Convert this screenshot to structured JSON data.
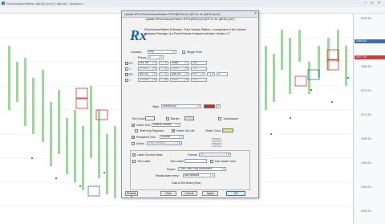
{
  "window": {
    "title": "PriceVolumePattern @ES#  [1m*] 1 Minute*, Session:1"
  },
  "chart": {
    "axis_labels": [
      "2090.00",
      "2085.00",
      "2080.00",
      "2075.00",
      "2070.00",
      "2065.00",
      "2060.00",
      "2055.00",
      "2050.00"
    ],
    "tags": [
      "2084.50",
      "2077.25"
    ]
  },
  "dialog": {
    "title": "Update RFCCPriceVolumePattern RTIC@ES# [1m*]CP-A: for @ES# [1m*]",
    "header": "Update hPriceVolumePattern RTIC@ES# [1m*]CP-A: for @ES# [1m*]",
    "description": "PriceVolumePattern Extension: Price Volume Pattern, a component of the Volume Analyses Package, is a PricevVolume Analyses indicator. Version 1.7",
    "location_label": "Location",
    "location_value": "Any",
    "single_price_label": "Single Price",
    "prices_label": "Prices",
    "prices_value": "2",
    "rows": [
      {
        "label": "P1:",
        "a": "Ask Vol",
        "op1": ">",
        "b": "Value",
        "v": "100",
        "enabled": true
      },
      {
        "label": "&:",
        "a": "Volume",
        "op1": ">",
        "b": "Value",
        "v": "100",
        "enabled": false
      },
      {
        "label": "P2:",
        "a": "Bid Vol",
        "op1": ">",
        "b": "Ask Vol",
        "v": "P2+",
        "op2": "*",
        "v2": "3",
        "enabled": true
      },
      {
        "label": "&:",
        "a": "Volume",
        "op1": ">",
        "b": "Value",
        "v": "100",
        "enabled": false
      }
    ],
    "style_label": "Style:",
    "style_value": "Hollow Box",
    "text_color_label": "Text Color:",
    "border_label": "Border",
    "translucent_label": "Translucent",
    "hover_text_label": "Hover Text",
    "hover_text_value": "Pattern Details",
    "shift_key_label": "Shift Key Required",
    "hover_on_left_label": "Hover On Left",
    "hover_color_label": "Hover Color",
    "persistent_text_label": "Persistent Text:",
    "persistent_text_value": "Volume",
    "action_label": "Action",
    "action_value": "Play Continue",
    "action_btn1": "Play",
    "action_btn2": "Edit",
    "label_current_value_label": "Label Current Value",
    "format_label": "Format:",
    "format_value": "##",
    "text_label_label": "Text Label",
    "text_label_label2": "Text Label:",
    "use_scale_color_label": "Use Scale Color",
    "scope_label": "Scope:",
    "scope_value": "This Chart, Any Instrument",
    "recalc_label": "Recalculate every:",
    "recalc_value": "use defaults",
    "calc_text": "Calc'd 304 times (0ms)",
    "presets_label": "Presets",
    "help_label": "Help",
    "cancel_label": "Cancel",
    "apply_label": "Apply",
    "ok_label": "OK",
    "colors": {
      "style_color": "#e02020",
      "hover_color": "#f5e84a",
      "text_color": "#ffffff"
    }
  }
}
